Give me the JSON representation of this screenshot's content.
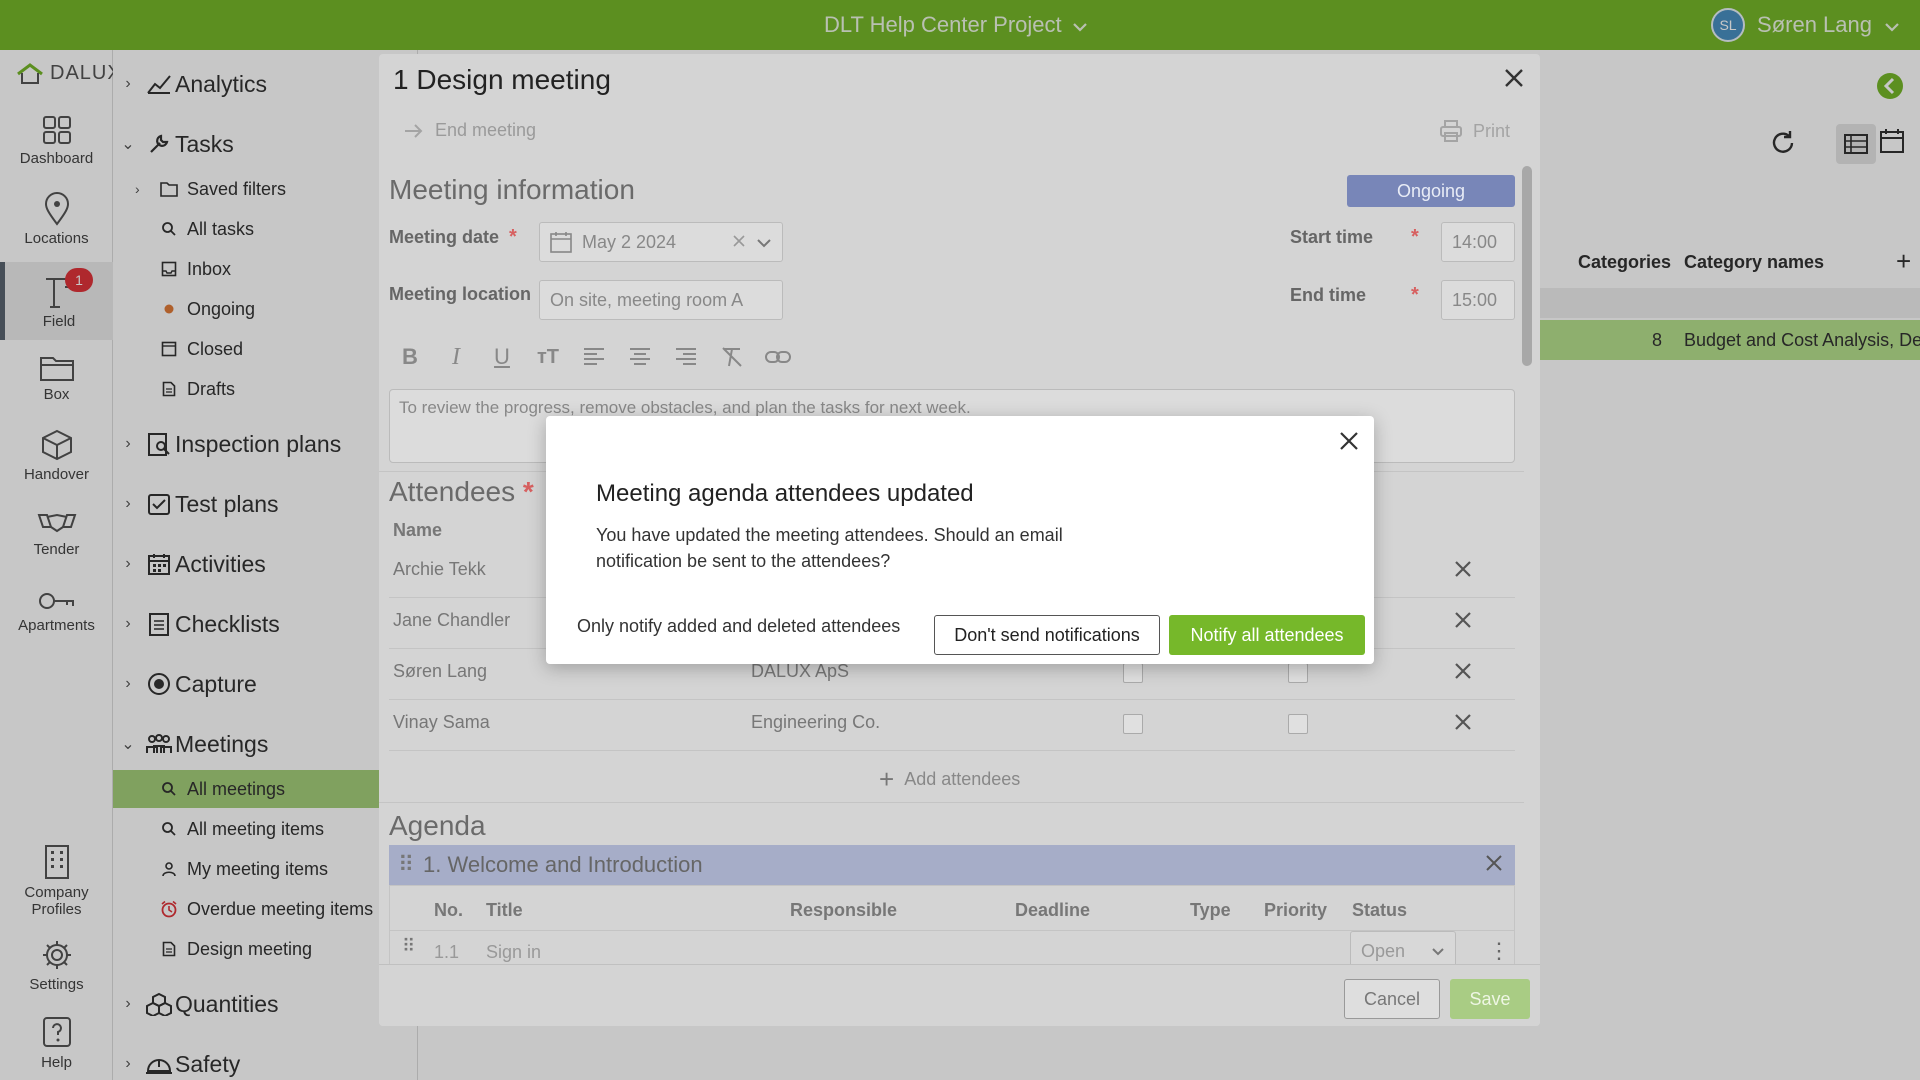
{
  "topbar": {
    "project": "DLT Help Center Project",
    "user_initials": "SL",
    "user_name": "Søren Lang"
  },
  "rail": {
    "logo": "DALUX",
    "items": [
      {
        "label": "Dashboard",
        "icon": "dashboard-icon"
      },
      {
        "label": "Locations",
        "icon": "location-pin-icon"
      },
      {
        "label": "Field",
        "icon": "crane-icon",
        "badge": "1"
      },
      {
        "label": "Box",
        "icon": "folder-icon"
      },
      {
        "label": "Handover",
        "icon": "box-icon"
      },
      {
        "label": "Tender",
        "icon": "handshake-icon"
      },
      {
        "label": "Apartments",
        "icon": "key-icon"
      },
      {
        "label": "Company Profiles",
        "icon": "building-icon"
      },
      {
        "label": "Settings",
        "icon": "gear-icon"
      },
      {
        "label": "Help",
        "icon": "help-icon"
      }
    ]
  },
  "sidebar": {
    "analytics": "Analytics",
    "tasks": "Tasks",
    "tasks_items": [
      "Saved filters",
      "All tasks",
      "Inbox",
      "Ongoing",
      "Closed",
      "Drafts"
    ],
    "inspection_plans": "Inspection plans",
    "test_plans": "Test plans",
    "activities": "Activities",
    "checklists": "Checklists",
    "capture": "Capture",
    "meetings": "Meetings",
    "meetings_items": [
      "All meetings",
      "All meeting items",
      "My meeting items",
      "Overdue meeting items",
      "Design meeting"
    ],
    "quantities": "Quantities",
    "safety": "Safety"
  },
  "main": {
    "col_categories": "Categories",
    "col_category_names": "Category names",
    "row_count": "8",
    "row_names": "Budget and Cost Analysis, Des"
  },
  "modal": {
    "title": "1 Design meeting",
    "end_meeting": "End meeting",
    "print": "Print",
    "meeting_information": "Meeting information",
    "status": "Ongoing",
    "meeting_date_label": "Meeting date",
    "meeting_date_value": "May 2 2024",
    "meeting_location_label": "Meeting location",
    "meeting_location_placeholder": "On site, meeting room A",
    "start_time_label": "Start time",
    "start_time_value": "14:00",
    "end_time_label": "End time",
    "end_time_value": "15:00",
    "description": "To review the progress, remove obstacles, and plan the tasks for next week.",
    "attendees_heading": "Attendees",
    "name_col": "Name",
    "attendees": [
      {
        "name": "Archie Tekk",
        "company": ""
      },
      {
        "name": "Jane Chandler",
        "company": ""
      },
      {
        "name": "Søren Lang",
        "company": "DALUX ApS"
      },
      {
        "name": "Vinay Sama",
        "company": "Engineering Co."
      }
    ],
    "add_attendees": "Add attendees",
    "agenda_heading": "Agenda",
    "agenda_item": "1. Welcome and Introduction",
    "agenda_cols": [
      "No.",
      "Title",
      "Responsible",
      "Deadline",
      "Type",
      "Priority",
      "Status"
    ],
    "agenda_row": {
      "no": "1.1",
      "title": "Sign in",
      "status": "Open"
    },
    "cancel": "Cancel",
    "save": "Save"
  },
  "dialog": {
    "title": "Meeting agenda attendees updated",
    "message": "You have updated the meeting attendees. Should an email notification be sent to the attendees?",
    "only_notify": "Only notify added and deleted attendees",
    "dont_send": "Don't send notifications",
    "notify_all": "Notify all attendees"
  },
  "colors": {
    "brand_green": "#76b82a",
    "status_ongoing": "#7886b8",
    "alert_red": "#e0343a"
  }
}
